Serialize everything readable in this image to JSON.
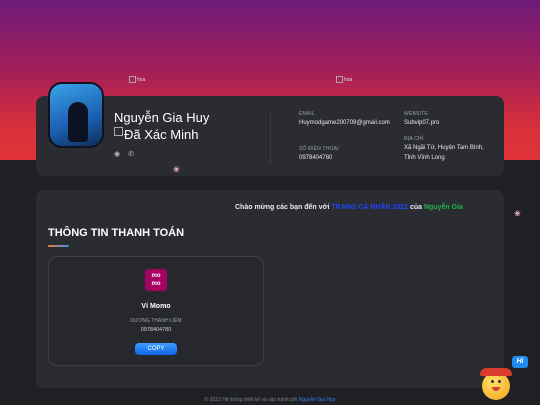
{
  "decor": {
    "flower_alt": "hoa",
    "petal_glyph": "❀"
  },
  "profile": {
    "name": "Nguyễn Gia Huy",
    "verified_alt": "Đã Xác Minh",
    "social_icons": [
      "facebook-icon",
      "phone-icon"
    ]
  },
  "info": {
    "email_label": "EMAIL",
    "email_value": "Huymodgame200709@gmail.com",
    "phone_label": "SỐ ĐIỆN THOẠI",
    "phone_value": "0978404780",
    "website_label": "WEBSITE",
    "website_value": "Subvip07.pro",
    "address_label": "ĐỊA CHỈ",
    "address_value": "Xã Ngãi Tứ, Huyện Tam Bình, Tỉnh Vĩnh Long"
  },
  "welcome": {
    "prefix": "Chào mừng các bạn đến với",
    "site": "TRANG CÁ NHÂN 2022",
    "middle": "của",
    "owner": "Nguyễn Gia"
  },
  "payment": {
    "section_title": "THÔNG TIN THANH TOÁN",
    "logo_text_top": "mo",
    "logo_text_bottom": "mo",
    "method_name": "Ví Momo",
    "account_holder": "DƯƠNG THANH LIÊM",
    "account_number": "0978404780",
    "copy_label": "COPY"
  },
  "footer": {
    "prefix": "© 2022 Hệ thống thiết kế và vận hành bởi",
    "author": "Nguyễn Gia Huy"
  },
  "mascot": {
    "badge_text": "Hi"
  },
  "colors": {
    "accent_blue": "#1064e8",
    "momo_brand": "#a50064",
    "welcome_site": "#1f46ff",
    "welcome_owner": "#1fb34a"
  }
}
